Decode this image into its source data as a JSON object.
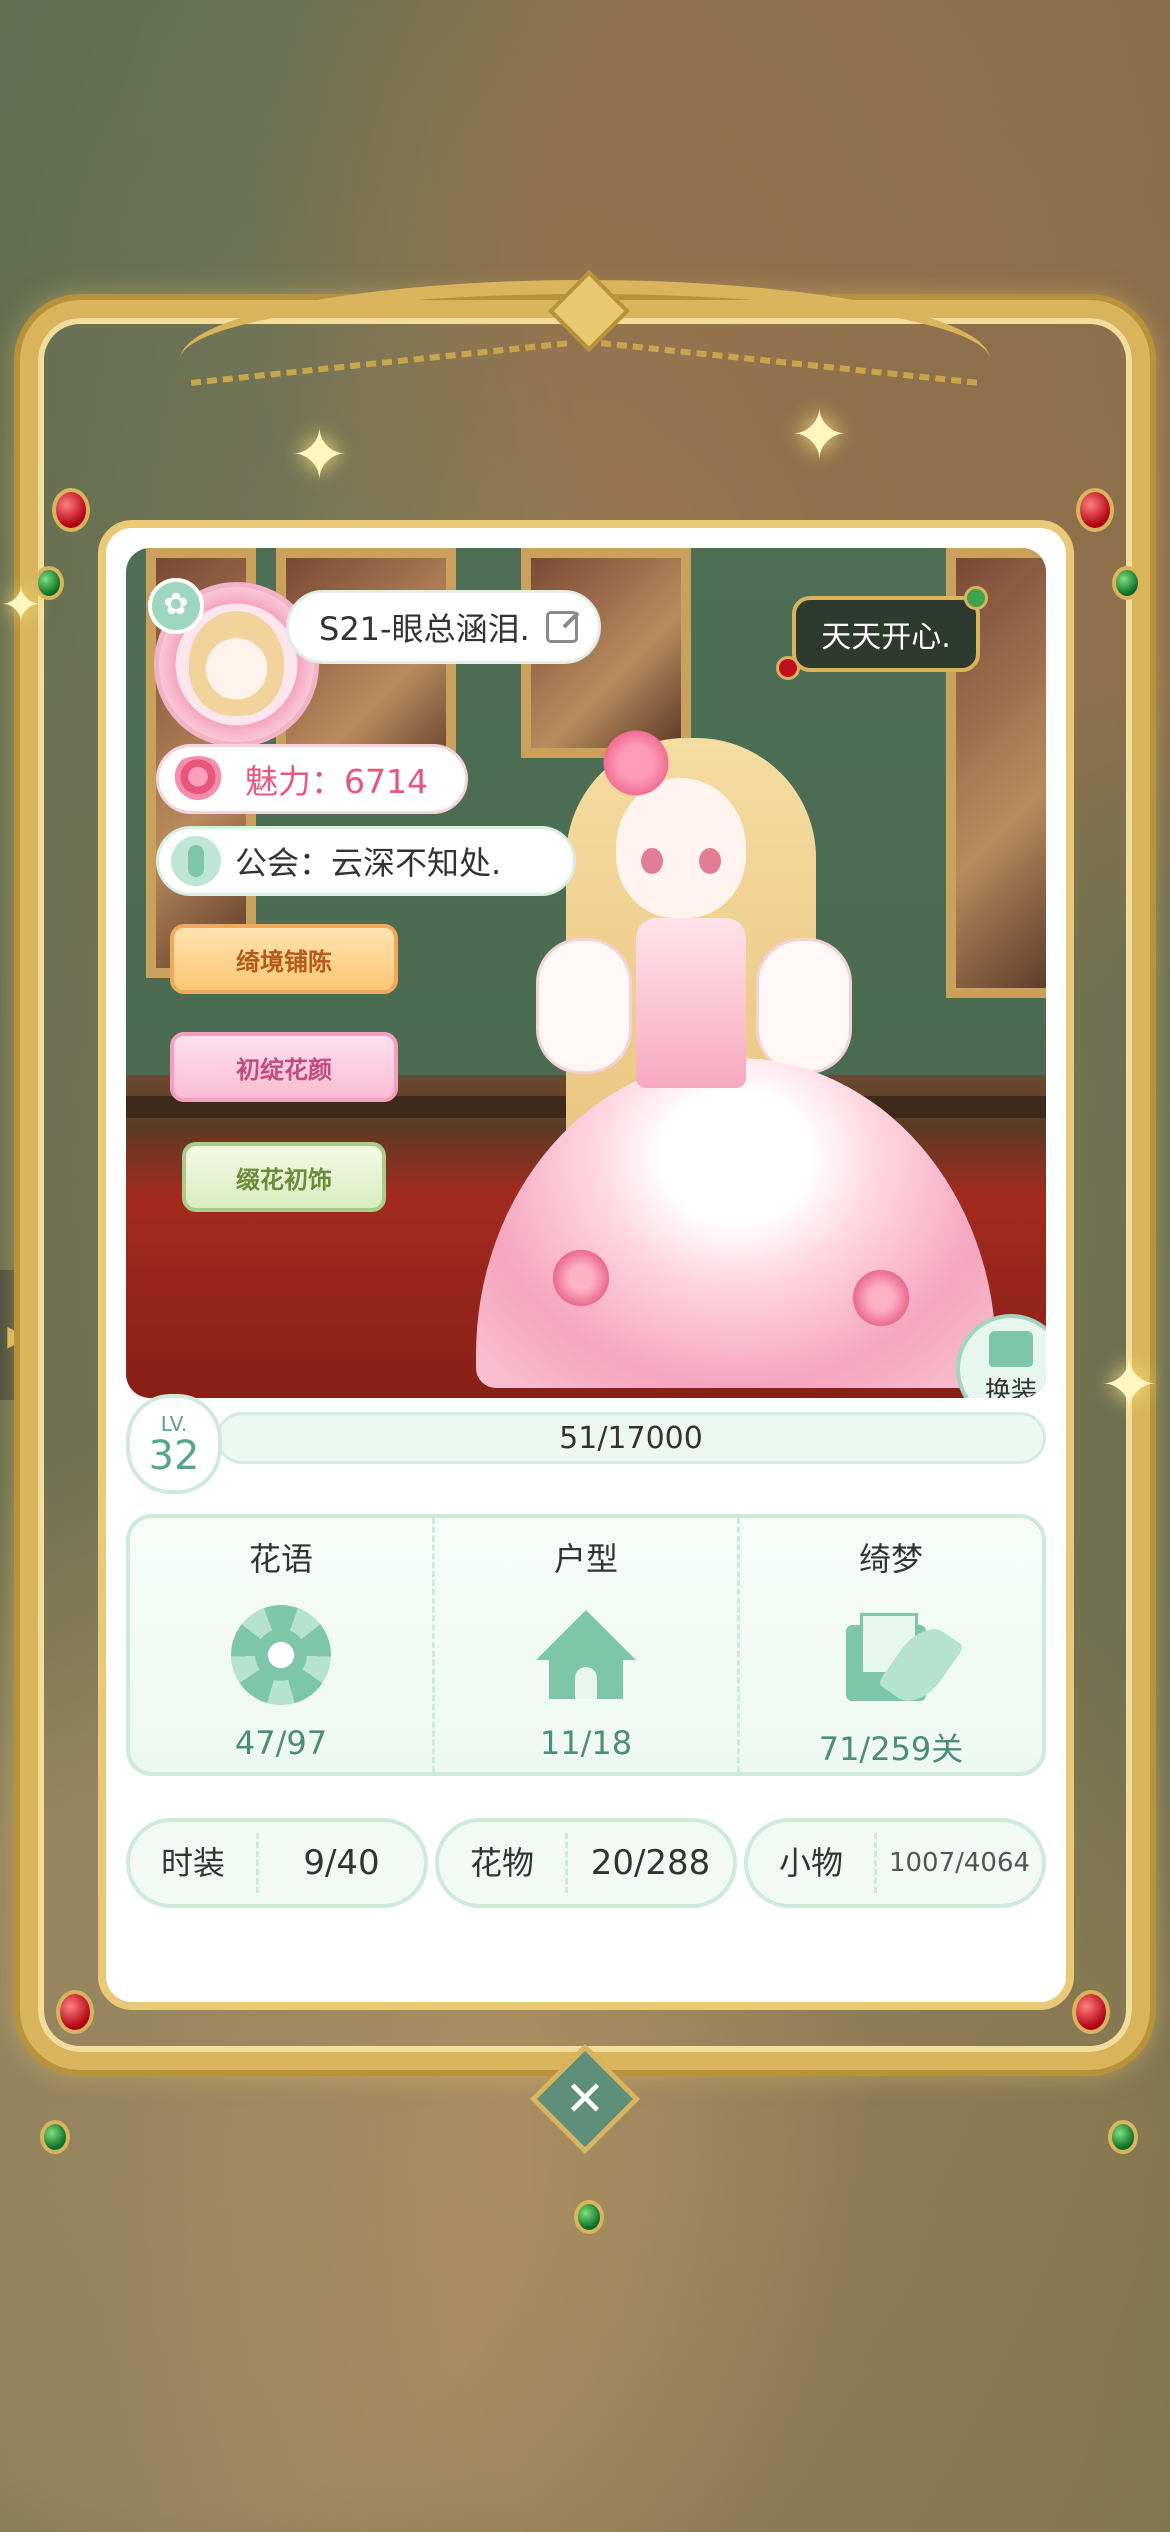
{
  "profile": {
    "name": "S21-眼总涵泪.",
    "charm_label": "魅力：6714",
    "guild_label": "公会：云深不知处.",
    "status_message": "天天开心."
  },
  "badges": [
    "绮境铺陈",
    "初绽花颜",
    "缀花初饰"
  ],
  "actions": {
    "change_outfit": "换装",
    "close": "✕"
  },
  "level": {
    "label": "LV.",
    "value": "32",
    "progress": "51/17000",
    "progress_fraction": 0.003
  },
  "stats": [
    {
      "title": "花语",
      "icon": "flower-icon",
      "value": "47/97"
    },
    {
      "title": "户型",
      "icon": "house-icon",
      "value": "11/18"
    },
    {
      "title": "绮梦",
      "icon": "letter-quill-icon",
      "value": "71/259关"
    }
  ],
  "collections": [
    {
      "label": "时装",
      "value": "9/40"
    },
    {
      "label": "花物",
      "value": "20/288"
    },
    {
      "label": "小物",
      "value": "1007/4064"
    }
  ],
  "colors": {
    "accent": "#7dc7a8",
    "gold": "#d9b45c",
    "charm": "#e8577b"
  }
}
